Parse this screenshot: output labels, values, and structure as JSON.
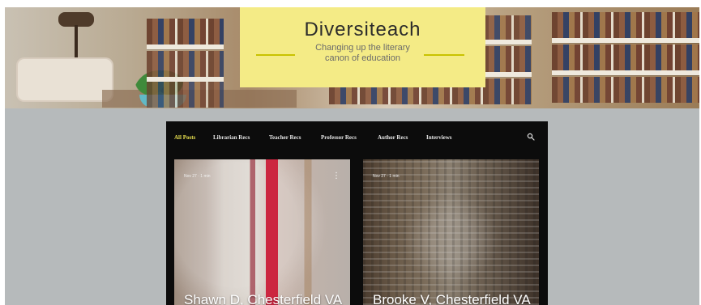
{
  "header": {
    "site_title": "Diversiteach",
    "subtitle_line1": "Changing up the literary",
    "subtitle_line2": "canon of education"
  },
  "nav": {
    "items": [
      {
        "label": "All Posts",
        "active": true
      },
      {
        "label": "Librarian Recs",
        "active": false
      },
      {
        "label": "Teacher Recs",
        "active": false
      },
      {
        "label": "Professor Recs",
        "active": false
      },
      {
        "label": "Author Recs",
        "active": false
      },
      {
        "label": "Interviews",
        "active": false
      }
    ],
    "search_icon": "search-icon"
  },
  "posts": [
    {
      "meta": "Nov 27 · 1 min",
      "title": "Shawn D, Chesterfield VA",
      "more_icon": "more-vertical-icon"
    },
    {
      "meta": "Nov 27 · 1 min",
      "title": "Brooke V, Chesterfield VA"
    }
  ],
  "colors": {
    "banner": "#f4eb86",
    "accent_active_nav": "#e7df4f",
    "page_background": "#b6babb",
    "feed_background": "#0c0c0c"
  }
}
